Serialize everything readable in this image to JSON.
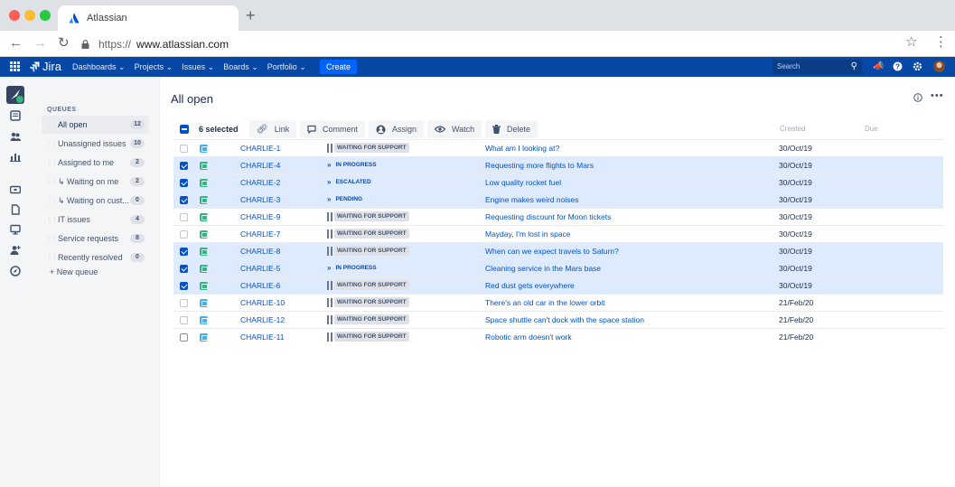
{
  "browser": {
    "tab_title": "Atlassian",
    "url_protocol": "https://",
    "url_host": "www.atlassian.com"
  },
  "jira_nav": {
    "product": "Jira",
    "menu": [
      "Dashboards ⌄",
      "Projects ⌄",
      "Issues ⌄",
      "Boards ⌄",
      "Portfolio ⌄"
    ],
    "create_label": "Create",
    "search_placeholder": "Search",
    "accent": "#0747A6"
  },
  "queues": {
    "title": "QUEUES",
    "items": [
      {
        "label": "All open",
        "count": "12"
      },
      {
        "label": "Unassigned issues",
        "count": "10"
      },
      {
        "label": "Assigned to me",
        "count": "2"
      },
      {
        "label": "↳ Waiting on me",
        "count": "2"
      },
      {
        "label": "↳ Waiting on cust...",
        "count": "0"
      },
      {
        "label": "IT issues",
        "count": "4"
      },
      {
        "label": "Service requests",
        "count": "8"
      },
      {
        "label": "Recently resolved",
        "count": "0"
      }
    ],
    "new_queue": "+ New queue"
  },
  "main": {
    "title": "All open",
    "toolbar": {
      "selected": "6 selected",
      "link": "Link",
      "comment": "Comment",
      "assign": "Assign",
      "watch": "Watch",
      "delete": "Delete"
    },
    "columns": {
      "created": "Created",
      "due": "Due"
    },
    "rows": [
      {
        "key": "CHARLIE-1",
        "status": "WAITING FOR SUPPORT",
        "summary": "What am I looking at?",
        "created": "30/Oct/19"
      },
      {
        "key": "CHARLIE-4",
        "status": "IN PROGRESS",
        "summary": "Requesting more flights to Mars",
        "created": "30/Oct/19"
      },
      {
        "key": "CHARLIE-2",
        "status": "ESCALATED",
        "summary": "Low quality rocket fuel",
        "created": "30/Oct/19"
      },
      {
        "key": "CHARLIE-3",
        "status": "PENDING",
        "summary": "Engine makes weird noises",
        "created": "30/Oct/19"
      },
      {
        "key": "CHARLIE-9",
        "status": "WAITING FOR SUPPORT",
        "summary": "Requesting discount for Moon tickets",
        "created": "30/Oct/19"
      },
      {
        "key": "CHARLIE-7",
        "status": "WAITING FOR SUPPORT",
        "summary": "Mayday, I'm lost in space",
        "created": "30/Oct/19"
      },
      {
        "key": "CHARLIE-8",
        "status": "WAITING FOR SUPPORT",
        "summary": "When can we expect travels to Saturn?",
        "created": "30/Oct/19"
      },
      {
        "key": "CHARLIE-5",
        "status": "IN PROGRESS",
        "summary": "Cleaning service in the Mars base",
        "created": "30/Oct/19"
      },
      {
        "key": "CHARLIE-6",
        "status": "WAITING FOR SUPPORT",
        "summary": "Red dust gets everywhere",
        "created": "30/Oct/19"
      },
      {
        "key": "CHARLIE-10",
        "status": "WAITING FOR SUPPORT",
        "summary": "There's an old car in the lower orbit",
        "created": "21/Feb/20"
      },
      {
        "key": "CHARLIE-12",
        "status": "WAITING FOR SUPPORT",
        "summary": "Space shuttle can't dock with the space station",
        "created": "21/Feb/20"
      },
      {
        "key": "CHARLIE-11",
        "status": "WAITING FOR SUPPORT",
        "summary": "Robotic arm doesn't work",
        "created": "21/Feb/20"
      }
    ]
  }
}
